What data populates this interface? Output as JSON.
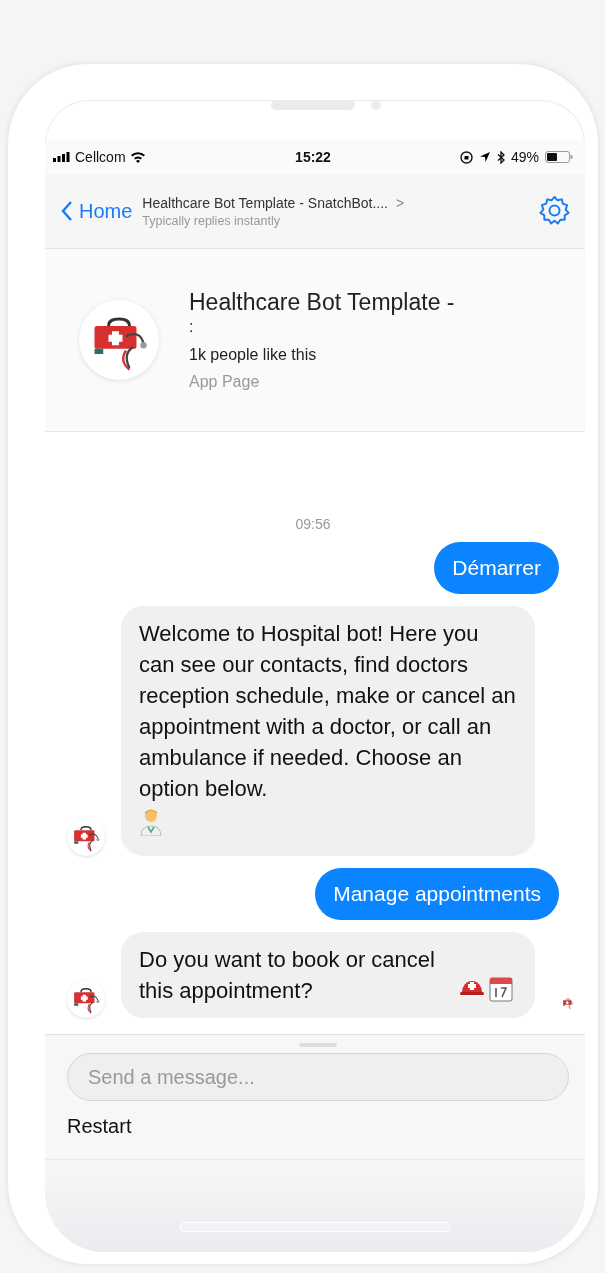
{
  "status_bar": {
    "carrier": "Cellcom",
    "time": "15:22",
    "battery": "49%"
  },
  "nav": {
    "back": "Home",
    "title": "Healthcare Bot Template - SnatchBot....",
    "chevron": ">",
    "subtitle": "Typically replies instantly"
  },
  "page_card": {
    "title": "Healthcare Bot Template -",
    "title_line_2": ":",
    "likes": "1k people like this",
    "category": "App Page"
  },
  "messages": [
    {
      "kind": "time",
      "text": "09:56"
    },
    {
      "kind": "user",
      "text": "Démarrer"
    },
    {
      "kind": "bot",
      "text": "Welcome to Hospital bot! Here you can see our contacts, find doctors reception schedule, make or cancel an appointment with a doctor, or call an ambulance if needed. Choose an option below."
    },
    {
      "kind": "user",
      "text": "Manage appointments"
    },
    {
      "kind": "bot",
      "text": "Do you want to book or cancel this appointment?"
    }
  ],
  "composer": {
    "placeholder": "Send a message..."
  },
  "quick_replies": [
    "Restart"
  ]
}
